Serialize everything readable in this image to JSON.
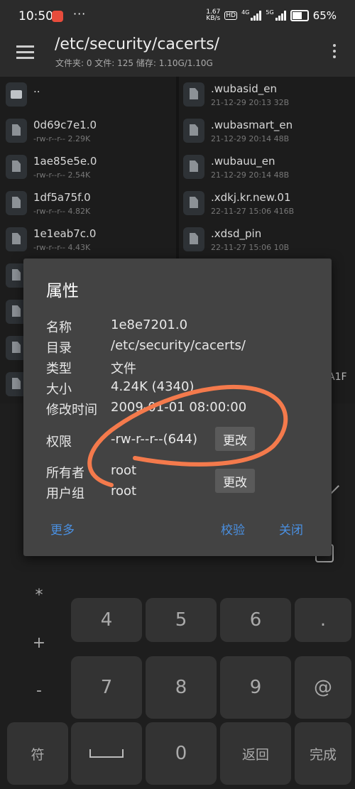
{
  "status_bar": {
    "time": "10:50",
    "dots": "···",
    "net_speed_value": "1.67",
    "net_speed_unit": "KB/s",
    "hd": "HD",
    "sig1": "4G",
    "sig2": "5G",
    "battery": "65%"
  },
  "app_bar": {
    "path": "/etc/security/cacerts/",
    "summary": "文件夹: 0  文件: 125  储存: 1.10G/1.10G"
  },
  "left_files": [
    {
      "name": "..",
      "meta": "",
      "type": "folder"
    },
    {
      "name": "0d69c7e1.0",
      "meta": "-rw-r--r--  2.29K",
      "type": "file"
    },
    {
      "name": "1ae85e5e.0",
      "meta": "-rw-r--r--  2.54K",
      "type": "file"
    },
    {
      "name": "1df5a75f.0",
      "meta": "-rw-r--r--  4.82K",
      "type": "file"
    },
    {
      "name": "1e1eab7c.0",
      "meta": "-rw-r--r--  4.43K",
      "type": "file"
    }
  ],
  "right_files": [
    {
      "name": ".wubasid_en",
      "meta": "21-12-29 20:13  32B"
    },
    {
      "name": ".wubasmart_en",
      "meta": "21-12-29 20:14  48B"
    },
    {
      "name": ".wubauu_en",
      "meta": "21-12-29 20:14  48B"
    },
    {
      "name": ".xdkj.kr.new.01",
      "meta": "22-11-27 15:06  416B"
    },
    {
      "name": ".xdsd_pin",
      "meta": "22-11-27 15:06  10B"
    }
  ],
  "edge_fragment": "A1F",
  "dialog": {
    "title": "属性",
    "properties": [
      {
        "label": "名称",
        "value": "1e8e7201.0"
      },
      {
        "label": "目录",
        "value": "/etc/security/cacerts/"
      },
      {
        "label": "类型",
        "value": "文件"
      },
      {
        "label": "大小",
        "value": "4.24K (4340)"
      },
      {
        "label": "修改时间",
        "value": "2009-01-01 08:00:00"
      },
      {
        "label": "权限",
        "value": "-rw-r--r--(644)"
      },
      {
        "label": "所有者",
        "value": "root"
      },
      {
        "label": "用户组",
        "value": "root"
      }
    ],
    "change_button": "更改",
    "change_owner_button": "更改",
    "actions": {
      "more": "更多",
      "verify": "校验",
      "close": "关闭"
    }
  },
  "keypad": {
    "side_keys": [
      "*",
      "+",
      "-"
    ],
    "digits": [
      "4",
      "5",
      "6",
      "7",
      "8",
      "9",
      "0"
    ],
    "dot": ".",
    "at": "@",
    "symbols": "符",
    "back": "返回",
    "done": "完成"
  },
  "colors": {
    "accent": "#4a90e2",
    "annotation": "#f47a4c",
    "dialog_bg": "#434343"
  }
}
